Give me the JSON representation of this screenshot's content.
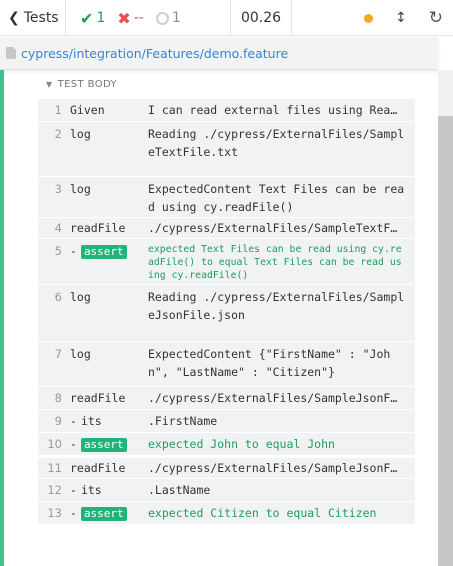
{
  "topbar": {
    "tests_label": "Tests",
    "passed": "1",
    "failed": "--",
    "pending": "1",
    "duration": "00.26"
  },
  "pathbar": {
    "path": "cypress/integration/Features/demo.feature"
  },
  "test_body": {
    "header": "TEST BODY",
    "rows": [
      {
        "num": "1",
        "cmd": "Given",
        "msg": "I can read external files using Rea…"
      },
      {
        "num": "2",
        "cmd": "log",
        "msg": "Reading ./cypress/ExternalFiles/SampleTextFile.txt"
      },
      {
        "num": "3",
        "cmd": "log",
        "msg": "ExpectedContent Text Files can be read using cy.readFile()"
      },
      {
        "num": "4",
        "cmd": "readFile",
        "msg": "./cypress/ExternalFiles/SampleTextF…"
      },
      {
        "num": "5",
        "cmd": "assert",
        "msg": "expected  Text Files can be read using cy.readFile() to equal  Text Files can be read using cy.readFile()"
      },
      {
        "num": "6",
        "cmd": "log",
        "msg": "Reading ./cypress/ExternalFiles/SampleJsonFile.json"
      },
      {
        "num": "7",
        "cmd": "log",
        "msg": "ExpectedContent {\"FirstName\" : \"John\", \"LastName\" : \"Citizen\"}"
      },
      {
        "num": "8",
        "cmd": "readFile",
        "msg": "./cypress/ExternalFiles/SampleJsonF…"
      },
      {
        "num": "9",
        "cmd": "its",
        "msg": ".FirstName"
      },
      {
        "num": "10",
        "cmd": "assert",
        "msg": "expected  John  to equal  John"
      },
      {
        "num": "11",
        "cmd": "readFile",
        "msg": "./cypress/ExternalFiles/SampleJsonF…"
      },
      {
        "num": "12",
        "cmd": "its",
        "msg": ".LastName"
      },
      {
        "num": "13",
        "cmd": "assert",
        "msg": "expected  Citizen  to equal  Citizen"
      }
    ]
  },
  "colors": {
    "pass": "#1e9e59",
    "fail": "#e94f4f",
    "accent": "#3ec28b",
    "link": "#3386d4",
    "status_dot": "#f5a623"
  },
  "icons": {
    "back": "chevron-left-icon",
    "pass": "check-icon",
    "fail": "x-icon",
    "pending": "spinner-icon",
    "status": "status-dot-icon",
    "scroll": "up-down-arrow-icon",
    "reload": "reload-icon",
    "file": "file-icon",
    "collapse": "triangle-down-icon"
  }
}
